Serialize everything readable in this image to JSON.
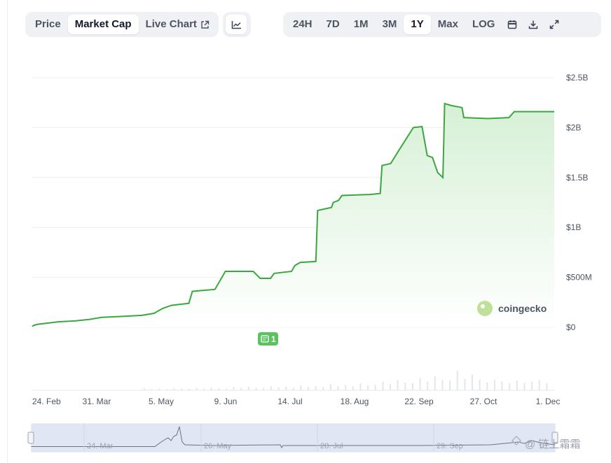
{
  "toolbar": {
    "tabs": [
      {
        "label": "Price"
      },
      {
        "label": "Market Cap"
      },
      {
        "label": "Live Chart"
      }
    ],
    "active_tab": "Market Cap",
    "chart_type_icon": "line-chart-icon",
    "ranges": [
      {
        "label": "24H"
      },
      {
        "label": "7D"
      },
      {
        "label": "1M"
      },
      {
        "label": "3M"
      },
      {
        "label": "1Y"
      },
      {
        "label": "Max"
      },
      {
        "label": "LOG"
      }
    ],
    "active_range": "1Y",
    "icons": [
      "calendar-icon",
      "download-icon",
      "fullscreen-icon"
    ]
  },
  "branding": {
    "logo_text": "coingecko"
  },
  "event_marker": {
    "label": "1",
    "icon": "news-icon"
  },
  "watermark": {
    "text": "@ 链上霜霜"
  },
  "colors": {
    "line": "#3aa83f",
    "area_top": "#d6f0d6",
    "area_bottom": "#ffffff",
    "volume": "#e3e6ea",
    "navigator_fill": "#e1e6f5",
    "navigator_line": "#6b7280",
    "event_marker": "#5cc25f"
  },
  "chart_data": {
    "type": "area",
    "x_type": "date",
    "x_ticks": [
      "24. Feb",
      "31. Mar",
      "5. May",
      "9. Jun",
      "14. Jul",
      "18. Aug",
      "22. Sep",
      "27. Oct",
      "1. Dec"
    ],
    "y_ticks": [
      "$0",
      "$500M",
      "$1B",
      "$1.5B",
      "$2B",
      "$2.5B"
    ],
    "ylim": [
      0,
      2.5
    ],
    "y_unit": "billion USD",
    "x_range": [
      "2024-02-22",
      "2024-12-18"
    ],
    "series": [
      {
        "points": [
          [
            "2024-02-22",
            0.01
          ],
          [
            "2024-02-23",
            0.02
          ],
          [
            "2024-02-25",
            0.03
          ],
          [
            "2024-03-01",
            0.04
          ],
          [
            "2024-03-08",
            0.055
          ],
          [
            "2024-03-18",
            0.065
          ],
          [
            "2024-03-26",
            0.08
          ],
          [
            "2024-04-02",
            0.1
          ],
          [
            "2024-04-15",
            0.11
          ],
          [
            "2024-04-25",
            0.12
          ],
          [
            "2024-05-02",
            0.14
          ],
          [
            "2024-05-07",
            0.19
          ],
          [
            "2024-05-12",
            0.22
          ],
          [
            "2024-05-22",
            0.24
          ],
          [
            "2024-05-24",
            0.36
          ],
          [
            "2024-06-06",
            0.38
          ],
          [
            "2024-06-10",
            0.5
          ],
          [
            "2024-06-12",
            0.56
          ],
          [
            "2024-06-28",
            0.56
          ],
          [
            "2024-07-02",
            0.49
          ],
          [
            "2024-07-08",
            0.49
          ],
          [
            "2024-07-10",
            0.54
          ],
          [
            "2024-07-20",
            0.56
          ],
          [
            "2024-07-22",
            0.62
          ],
          [
            "2024-07-25",
            0.65
          ],
          [
            "2024-08-03",
            0.66
          ],
          [
            "2024-08-04",
            1.17
          ],
          [
            "2024-08-12",
            1.2
          ],
          [
            "2024-08-13",
            1.25
          ],
          [
            "2024-08-16",
            1.27
          ],
          [
            "2024-08-18",
            1.32
          ],
          [
            "2024-09-03",
            1.33
          ],
          [
            "2024-09-09",
            1.34
          ],
          [
            "2024-09-10",
            1.62
          ],
          [
            "2024-09-15",
            1.64
          ],
          [
            "2024-09-20",
            1.78
          ],
          [
            "2024-09-28",
            2.0
          ],
          [
            "2024-10-03",
            2.01
          ],
          [
            "2024-10-06",
            1.72
          ],
          [
            "2024-10-09",
            1.7
          ],
          [
            "2024-10-12",
            1.55
          ],
          [
            "2024-10-15",
            1.5
          ],
          [
            "2024-10-16",
            2.24
          ],
          [
            "2024-10-20",
            2.22
          ],
          [
            "2024-10-26",
            2.2
          ],
          [
            "2024-10-27",
            2.1
          ],
          [
            "2024-11-10",
            2.09
          ],
          [
            "2024-11-22",
            2.1
          ],
          [
            "2024-11-25",
            2.16
          ],
          [
            "2024-12-18",
            2.16
          ]
        ]
      }
    ],
    "navigator_ticks": [
      "24. Mar",
      "26. May",
      "28. Jul",
      "29. Sep"
    ],
    "legend": null,
    "grid": true
  }
}
